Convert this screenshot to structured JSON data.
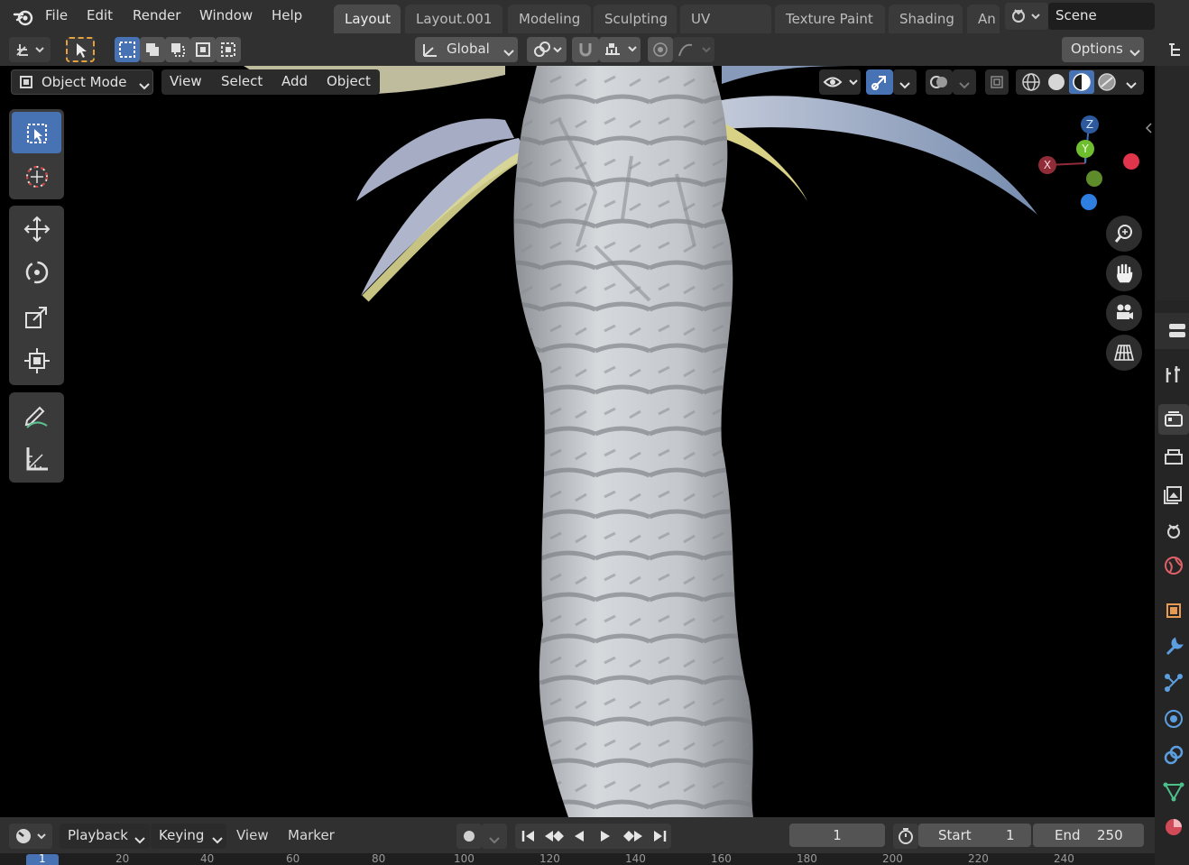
{
  "menubar": {
    "items": [
      "File",
      "Edit",
      "Render",
      "Window",
      "Help"
    ],
    "workspace_tabs": [
      "Layout",
      "Layout.001",
      "Modeling",
      "Sculpting",
      "UV Editing",
      "Texture Paint",
      "Shading",
      "An"
    ],
    "active_tab": "Layout",
    "scene_name": "Scene"
  },
  "header": {
    "orientation": "Global",
    "options_label": "Options"
  },
  "viewport_header": {
    "mode": "Object Mode",
    "menus": [
      "View",
      "Select",
      "Add",
      "Object"
    ]
  },
  "gizmo": {
    "x_label": "X",
    "y_label": "Y",
    "z_label": "Z",
    "colors": {
      "x": "#e0354a",
      "y": "#6fbe2f",
      "z": "#3c7ed9"
    }
  },
  "timeline": {
    "menus": [
      "Playback",
      "Keying",
      "View",
      "Marker"
    ],
    "current_frame": "1",
    "start_label": "Start",
    "start_value": "1",
    "end_label": "End",
    "end_value": "250",
    "ruler_ticks": [
      "1",
      "20",
      "40",
      "60",
      "80",
      "100",
      "120",
      "140",
      "160",
      "180",
      "200",
      "220",
      "240"
    ]
  },
  "colors": {
    "accent": "#4772b3",
    "panel": "#303030",
    "viewport_bg": "#000000"
  }
}
